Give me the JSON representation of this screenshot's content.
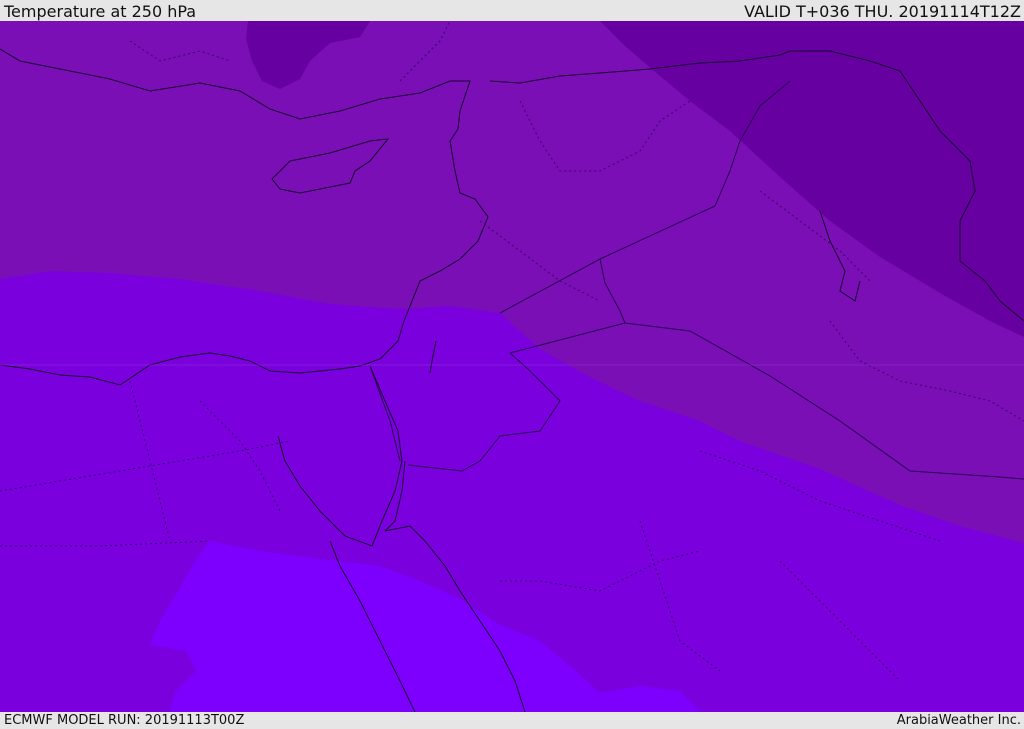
{
  "header": {
    "title": "Temperature at 250 hPa",
    "valid": "VALID T+036 THU. 20191114T12Z"
  },
  "footer": {
    "model_run": "ECMWF MODEL RUN: 20191113T00Z",
    "credit": "ArabiaWeather Inc."
  },
  "colors": {
    "coldest": "#6600a0",
    "cold": "#7a0fb5",
    "mid": "#7a00dd",
    "warm": "#7d00ff",
    "coastline": "#1a0033",
    "border": "#2a0055"
  }
}
